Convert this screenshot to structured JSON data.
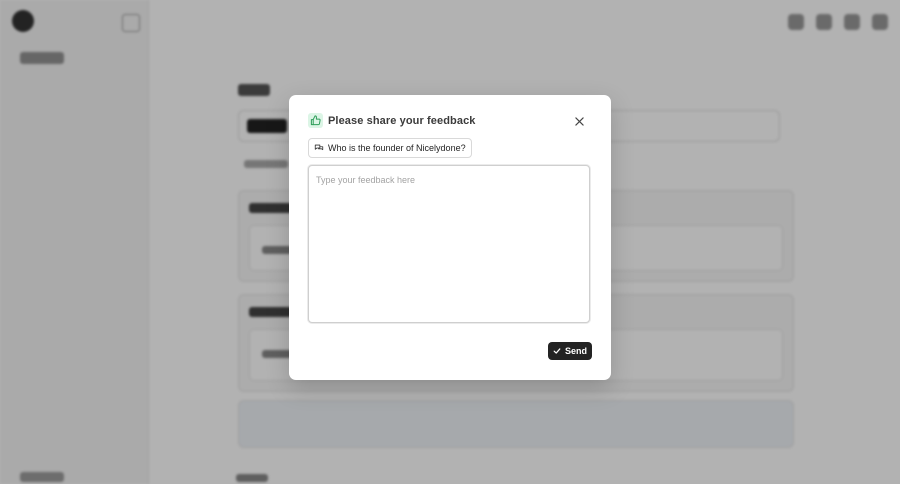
{
  "dialog": {
    "title": "Please share your feedback",
    "question": "Who is the founder of Nicelydone?",
    "feedback_placeholder": "Type your feedback here",
    "feedback_value": "",
    "send_label": "Send",
    "icons": {
      "header": "thumbs-up-icon",
      "question": "chat-bubbles-icon",
      "close": "close-icon",
      "send": "check-icon"
    },
    "colors": {
      "badge_bg": "#dcf5e6",
      "badge_fg": "#2f9e5a",
      "send_bg": "#232323"
    }
  }
}
